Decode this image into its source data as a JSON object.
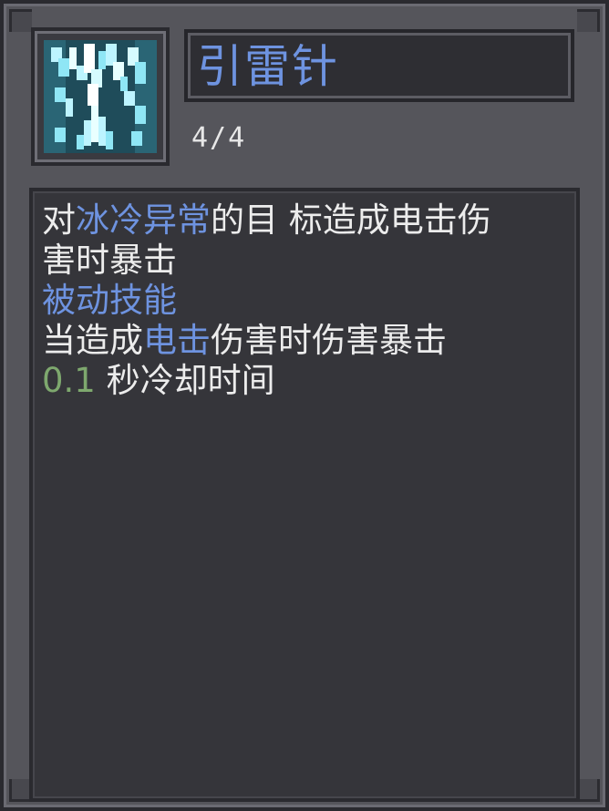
{
  "skill": {
    "name": "引雷针",
    "level": "4/4",
    "icon": "lightning-skill-icon"
  },
  "description": {
    "line1": {
      "prefix": "对",
      "highlight": "冰冷异常",
      "suffix": "的目 标造成电击伤"
    },
    "line2": "害时暴击",
    "line3": "被动技能",
    "line4": {
      "prefix": "当造成",
      "highlight": "电击",
      "suffix": "伤害时伤害暴击"
    },
    "line5": {
      "value": "0.1",
      "suffix": " 秒冷却时间"
    }
  },
  "colors": {
    "highlight_blue": "#6e93e0",
    "value_green": "#7ea86e",
    "text": "#ececec",
    "panel": "#35353a"
  }
}
